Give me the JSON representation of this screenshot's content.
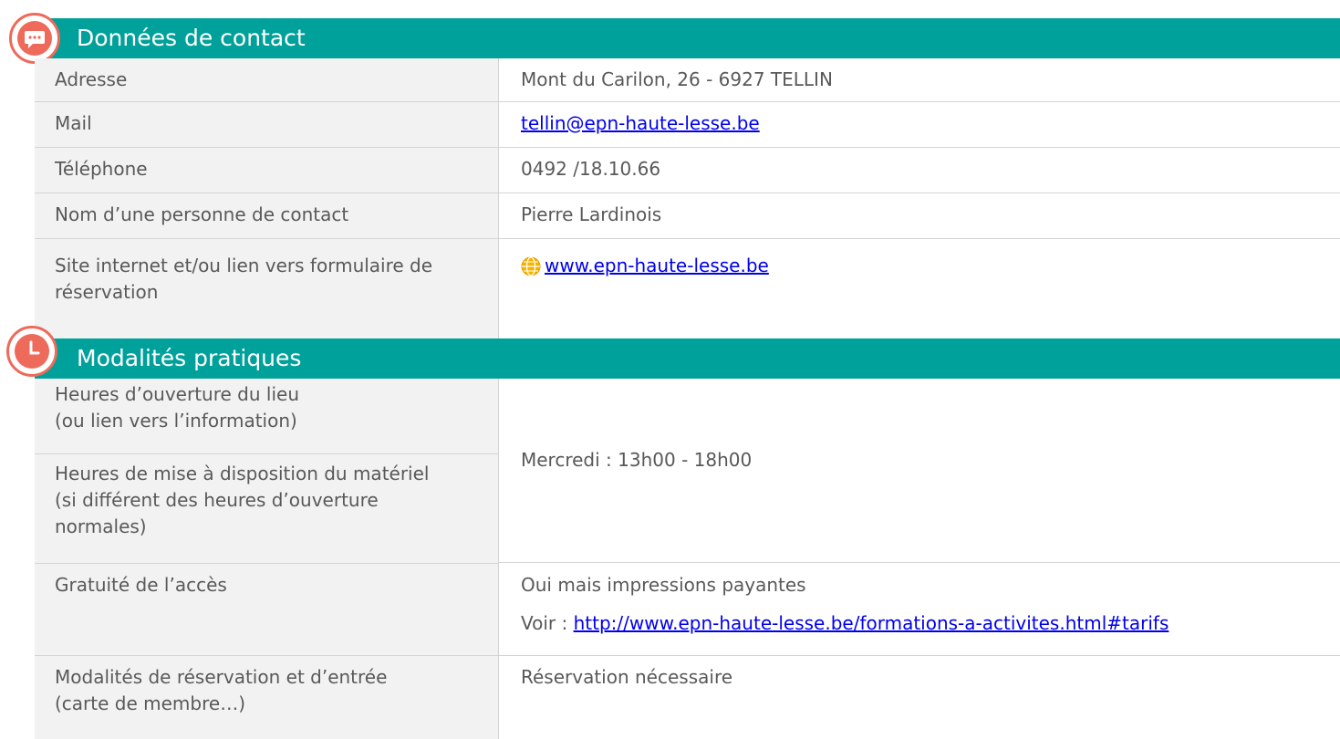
{
  "contact": {
    "title": "Données de contact",
    "address_label": "Adresse",
    "address_value": "Mont du Carilon, 26 - 6927  TELLIN",
    "mail_label": "Mail",
    "mail_value": "tellin@epn-haute-lesse.be",
    "phone_label": "Téléphone",
    "phone_value": "0492 /18.10.66",
    "person_label": "Nom d’une personne de contact",
    "person_value": "Pierre Lardinois",
    "site_label": "Site internet et/ou lien vers formulaire de réservation",
    "site_value": "www.epn-haute-lesse.be"
  },
  "practical": {
    "title": "Modalités pratiques",
    "opening_label_line1": "Heures d’ouverture du lieu",
    "opening_label_line2": "(ou lien vers l’information)",
    "equipment_label": "Heures de mise à disposition du matériel (si différent des heures d’ouverture normales)",
    "hours_value": "Mercredi : 13h00 - 18h00",
    "free_label": "Gratuité de l’accès",
    "free_value_line1": "Oui mais impressions payantes",
    "free_value_prefix": "Voir : ",
    "free_value_link": "http://www.epn-haute-lesse.be/formations-a-activites.html#tarifs",
    "booking_label": "Modalités de réservation et d’entrée (carte de membre…)",
    "booking_value": "Réservation nécessaire"
  },
  "icons": {
    "contact_icon": "speech-bubble-icon",
    "practical_icon": "clock-icon",
    "site_icon": "globe-icon"
  },
  "colors": {
    "header_bg": "#00a19a",
    "badge": "#ee6a5a",
    "label_bg": "#f2f2f2",
    "link": "#0000ee"
  }
}
